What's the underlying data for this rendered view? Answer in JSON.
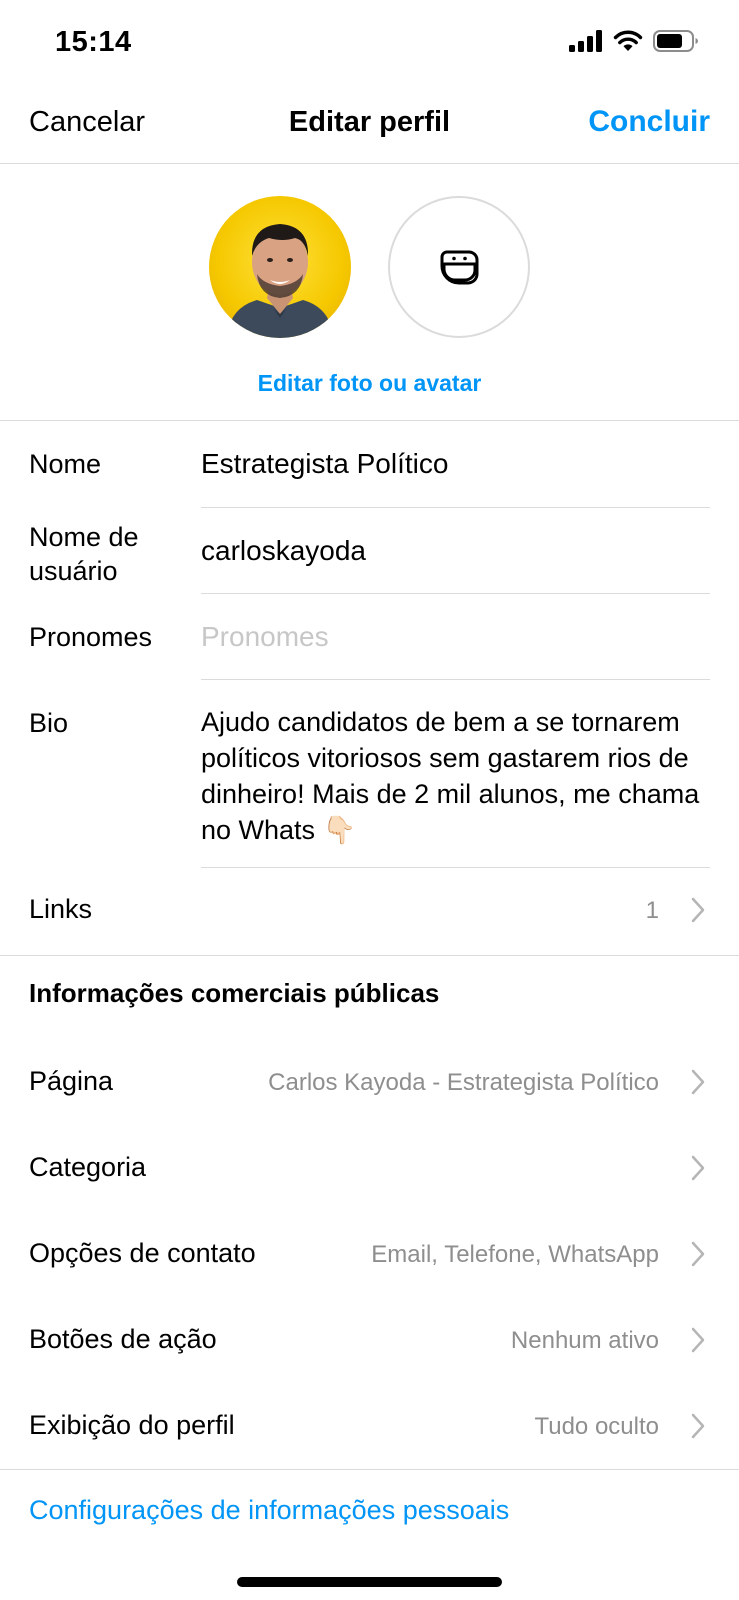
{
  "status": {
    "time": "15:14"
  },
  "nav": {
    "cancel": "Cancelar",
    "title": "Editar perfil",
    "done": "Concluir"
  },
  "photo": {
    "edit_link": "Editar foto ou avatar"
  },
  "fields": {
    "name": {
      "label": "Nome",
      "value": "Estrategista Político"
    },
    "username": {
      "label": "Nome de usuário",
      "value": "carloskayoda"
    },
    "pronouns": {
      "label": "Pronomes",
      "placeholder": "Pronomes"
    },
    "bio": {
      "label": "Bio",
      "value": "Ajudo candidatos de bem a se tornarem políticos vitoriosos sem gastarem rios de dinheiro! Mais de 2 mil alunos, me chama no Whats 👇🏻"
    },
    "links": {
      "label": "Links",
      "count": "1"
    }
  },
  "business": {
    "heading": "Informações comerciais públicas",
    "rows": [
      {
        "label": "Página",
        "detail": "Carlos Kayoda - Estrategista Político"
      },
      {
        "label": "Categoria",
        "detail": ""
      },
      {
        "label": "Opções de contato",
        "detail": "Email, Telefone, WhatsApp"
      },
      {
        "label": "Botões de ação",
        "detail": "Nenhum ativo"
      },
      {
        "label": "Exibição do perfil",
        "detail": "Tudo oculto"
      }
    ]
  },
  "footer": {
    "settings_link": "Configurações de informações pessoais"
  },
  "colors": {
    "accent": "#0095f6",
    "secondary_text": "#8e8e8e",
    "divider": "#dbdbdb"
  },
  "icons": [
    "signal-icon",
    "wifi-icon",
    "battery-icon",
    "avatar-sticker-icon",
    "chevron-right-icon"
  ]
}
